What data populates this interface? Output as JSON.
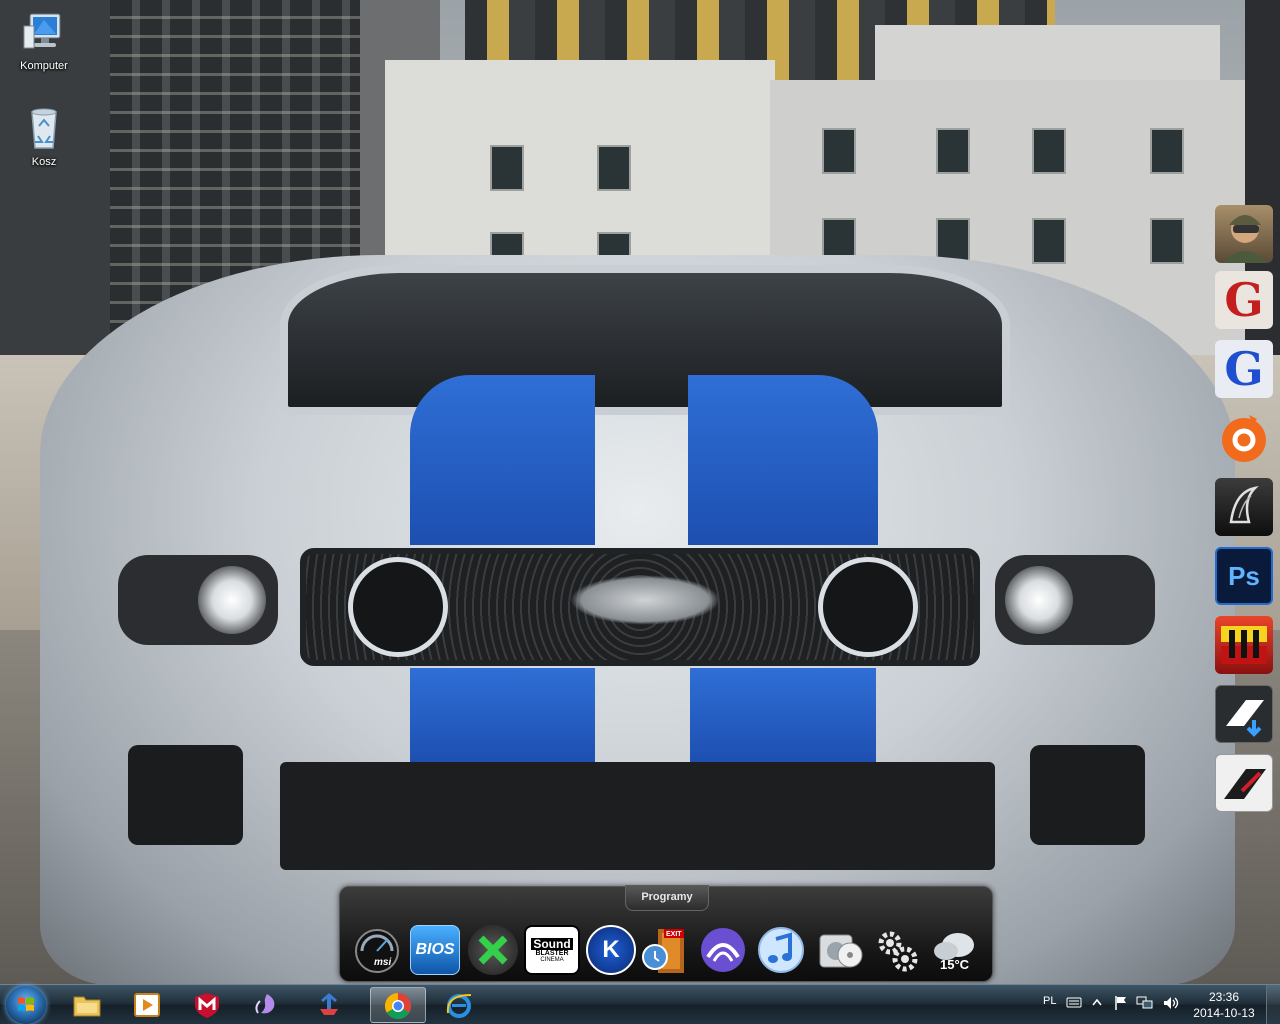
{
  "desktop": {
    "icons": [
      {
        "label": "Komputer",
        "icon": "computer-icon"
      },
      {
        "label": "Kosz",
        "icon": "recycle-bin-icon"
      }
    ]
  },
  "side_dock": {
    "apps": [
      {
        "icon": "soldier-game-icon"
      },
      {
        "icon": "gothic-g-red-icon",
        "glyph": "G"
      },
      {
        "icon": "gothic-g-blue-icon",
        "glyph": "G"
      },
      {
        "icon": "origin-icon"
      },
      {
        "icon": "inkscape-icon"
      },
      {
        "icon": "photoshop-icon",
        "glyph": "Ps"
      },
      {
        "icon": "ten-seconds-game-icon"
      },
      {
        "icon": "nfs-download-icon"
      },
      {
        "icon": "nfs-icon"
      }
    ]
  },
  "dock": {
    "title": "Programy",
    "items": [
      {
        "icon": "msi-afterburner-icon",
        "text": "msi"
      },
      {
        "icon": "bios-icon",
        "text": "BIOS"
      },
      {
        "icon": "xbox-tool-icon"
      },
      {
        "icon": "sound-blaster-icon",
        "text_top": "Sound",
        "text_mid": "BLASTER",
        "text_bot": "CINEMA"
      },
      {
        "icon": "k-lite-icon",
        "text": "K"
      },
      {
        "icon": "exit-icon",
        "text": "EXIT"
      },
      {
        "icon": "bittorrent-icon"
      },
      {
        "icon": "itunes-icon"
      },
      {
        "icon": "media-player-icon"
      },
      {
        "icon": "settings-gears-icon"
      },
      {
        "icon": "weather-icon",
        "text": "15°C"
      }
    ]
  },
  "taskbar": {
    "pinned": [
      {
        "icon": "explorer-folder-icon"
      },
      {
        "icon": "media-player-classic-icon"
      },
      {
        "icon": "mcafee-icon"
      },
      {
        "icon": "aion-icon"
      },
      {
        "icon": "networking-icon"
      },
      {
        "icon": "chrome-icon",
        "active": true
      },
      {
        "icon": "internet-explorer-icon"
      }
    ],
    "tray": {
      "language": "PL",
      "icons": [
        "keyboard-icon",
        "show-hidden-icon",
        "flag-icon",
        "network-icon",
        "volume-icon"
      ]
    },
    "clock": {
      "time": "23:36",
      "date": "2014-10-13"
    }
  },
  "colors": {
    "taskbar": "#1e2d38",
    "dock": "#161616",
    "stripe_blue": "#2f6fd6"
  }
}
